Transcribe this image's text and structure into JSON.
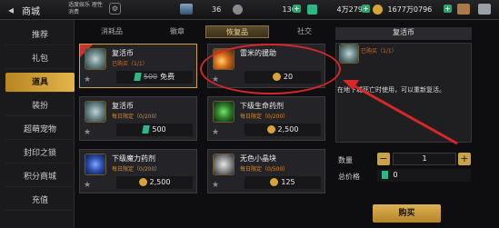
{
  "header": {
    "back": "◂",
    "title": "商城",
    "warning": "适度娱乐 理性消费",
    "gear": "⚙",
    "currencies": [
      {
        "value": "36"
      },
      {
        "value": "130"
      },
      {
        "value": "4万2797"
      },
      {
        "value": "1677万0796"
      }
    ]
  },
  "nav": {
    "items": [
      "推荐",
      "礼包",
      "道具",
      "装扮",
      "超萌宠物",
      "封印之锁",
      "积分商城",
      "充值"
    ],
    "active_index": 2
  },
  "tabs": {
    "items": [
      "消耗品",
      "徽章",
      "恢复品",
      "社交"
    ],
    "active_index": 2
  },
  "products": [
    {
      "name": "复活币",
      "limit": "已购买（1/1）",
      "old_price": "500",
      "price": "免费",
      "currency": "gem",
      "selected": true
    },
    {
      "name": "雷米的援助",
      "limit": "",
      "old_price": "",
      "price": "20",
      "currency": "gold",
      "selected": false
    },
    {
      "name": "复活币",
      "limit": "每日限定（0/200）",
      "old_price": "",
      "price": "500",
      "currency": "gem",
      "selected": false
    },
    {
      "name": "下级生命药剂",
      "limit": "每日限定（0/200）",
      "old_price": "",
      "price": "2,500",
      "currency": "gold",
      "selected": false
    },
    {
      "name": "下级魔力药剂",
      "limit": "每日限定（0/200）",
      "old_price": "",
      "price": "2,500",
      "currency": "gold",
      "selected": false
    },
    {
      "name": "无色小晶块",
      "limit": "每日限定（0/500）",
      "old_price": "",
      "price": "125",
      "currency": "gold",
      "selected": false
    }
  ],
  "detail": {
    "title": "复活币",
    "limit": "已购买（1/1）",
    "description": "在地下城死亡时使用，可以重新复活。",
    "qty_label": "数量",
    "qty_value": "1",
    "total_label": "总价格",
    "total_value": "0",
    "buy_label": "购买"
  },
  "colors": {
    "accent_gold": "#c9a24a",
    "gem_green": "#2fb586",
    "annotation_red": "#d8262a"
  }
}
